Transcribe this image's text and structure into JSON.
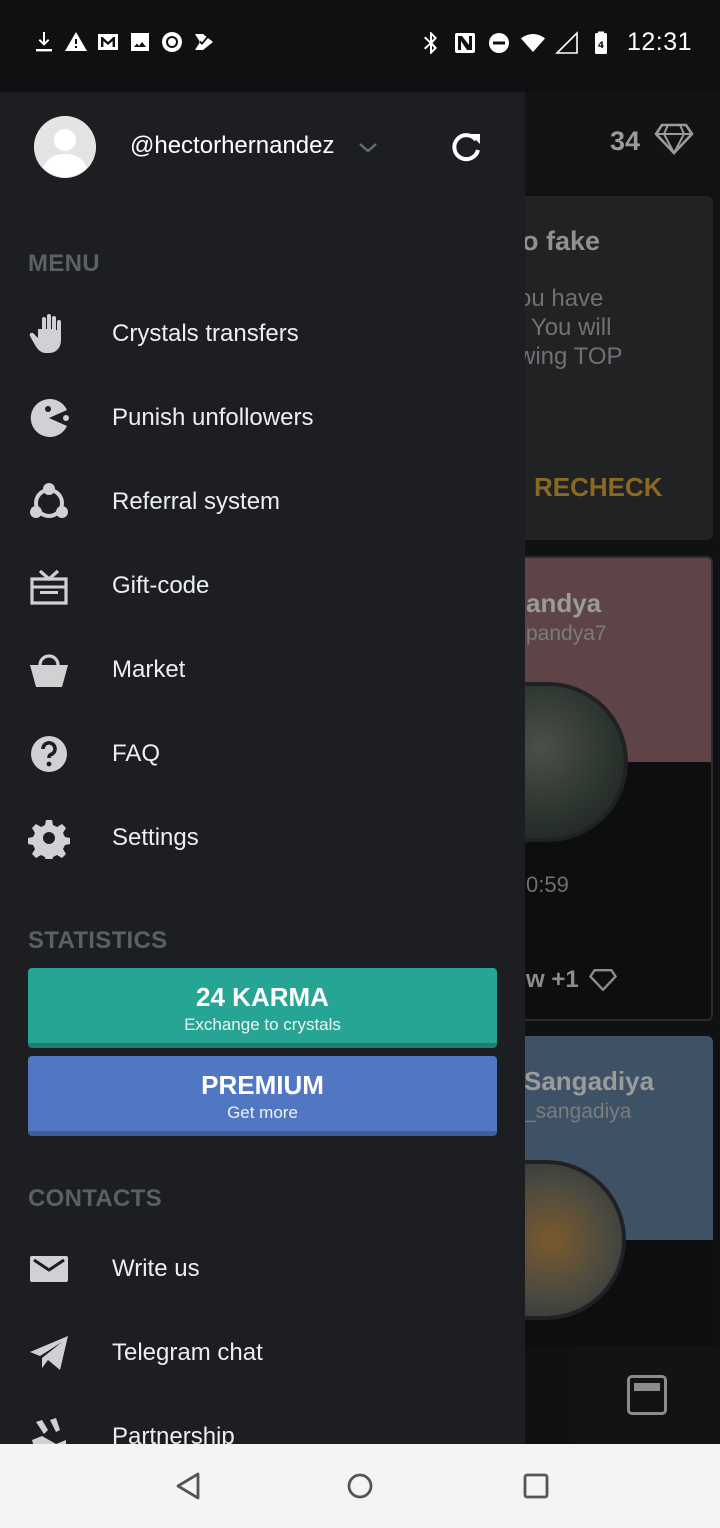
{
  "status_bar": {
    "time": "12:31",
    "battery_level": "4",
    "left_icons": [
      "download-icon",
      "warning-icon",
      "gmail-icon",
      "image-icon",
      "record-icon",
      "checkmark-app-icon"
    ],
    "right_icons": [
      "bluetooth-icon",
      "nfc-icon",
      "do-not-disturb-icon",
      "wifi-icon",
      "cell-signal-icon",
      "battery-icon"
    ]
  },
  "background_app": {
    "crystal_count": "34",
    "card1": {
      "title": "o fake",
      "body": "ou have\n. You will\nwing TOP",
      "action": "RECHECK"
    },
    "card2": {
      "name": "andya",
      "handle": "pandya7",
      "timer": "0:59",
      "follow": "w +1"
    },
    "card3": {
      "name": "Sangadiya",
      "handle": "_sangadiya"
    }
  },
  "drawer": {
    "username": "@hectorhernandez",
    "menu_title": "MENU",
    "menu_items": [
      {
        "label": "Crystals transfers",
        "icon": "hand-icon"
      },
      {
        "label": "Punish unfollowers",
        "icon": "pacman-icon"
      },
      {
        "label": "Referral system",
        "icon": "referral-icon"
      },
      {
        "label": "Gift-code",
        "icon": "gift-icon"
      },
      {
        "label": "Market",
        "icon": "basket-icon"
      },
      {
        "label": "FAQ",
        "icon": "help-icon"
      },
      {
        "label": "Settings",
        "icon": "gear-icon"
      }
    ],
    "statistics_title": "STATISTICS",
    "karma_button": {
      "main": "24 KARMA",
      "sub": "Exchange to crystals"
    },
    "premium_button": {
      "main": "PREMIUM",
      "sub": "Get more"
    },
    "contacts_title": "CONTACTS",
    "contact_items": [
      {
        "label": "Write us",
        "icon": "mail-icon"
      },
      {
        "label": "Telegram chat",
        "icon": "telegram-icon"
      },
      {
        "label": "Partnership",
        "icon": "handshake-icon"
      }
    ]
  },
  "colors": {
    "drawer_bg": "#1c1e21",
    "karma": "#26a595",
    "premium": "#5277c2",
    "recheck": "#8a6a22"
  }
}
